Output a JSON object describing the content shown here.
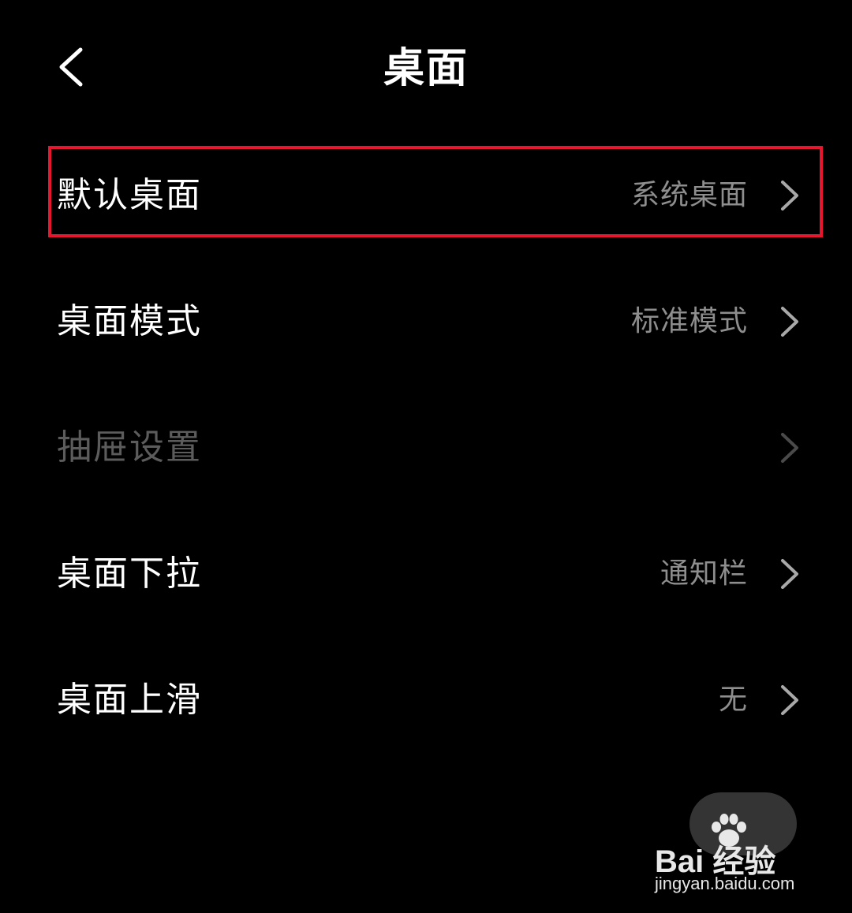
{
  "header": {
    "title": "桌面",
    "back_icon": "chevron-left-icon"
  },
  "settings": [
    {
      "label": "默认桌面",
      "value": "系统桌面",
      "enabled": true,
      "highlighted": true
    },
    {
      "label": "桌面模式",
      "value": "标准模式",
      "enabled": true,
      "highlighted": false
    },
    {
      "label": "抽屉设置",
      "value": "",
      "enabled": false,
      "highlighted": false
    },
    {
      "label": "桌面下拉",
      "value": "通知栏",
      "enabled": true,
      "highlighted": false
    },
    {
      "label": "桌面上滑",
      "value": "无",
      "enabled": true,
      "highlighted": false
    }
  ],
  "watermark": {
    "logo_text": "Bai 经验",
    "url": "jingyan.baidu.com"
  },
  "colors": {
    "background": "#000000",
    "primary_text": "#ffffff",
    "secondary_text": "#8e8e8e",
    "disabled_text": "#5c5c5c",
    "highlight_border": "#e5162e"
  }
}
